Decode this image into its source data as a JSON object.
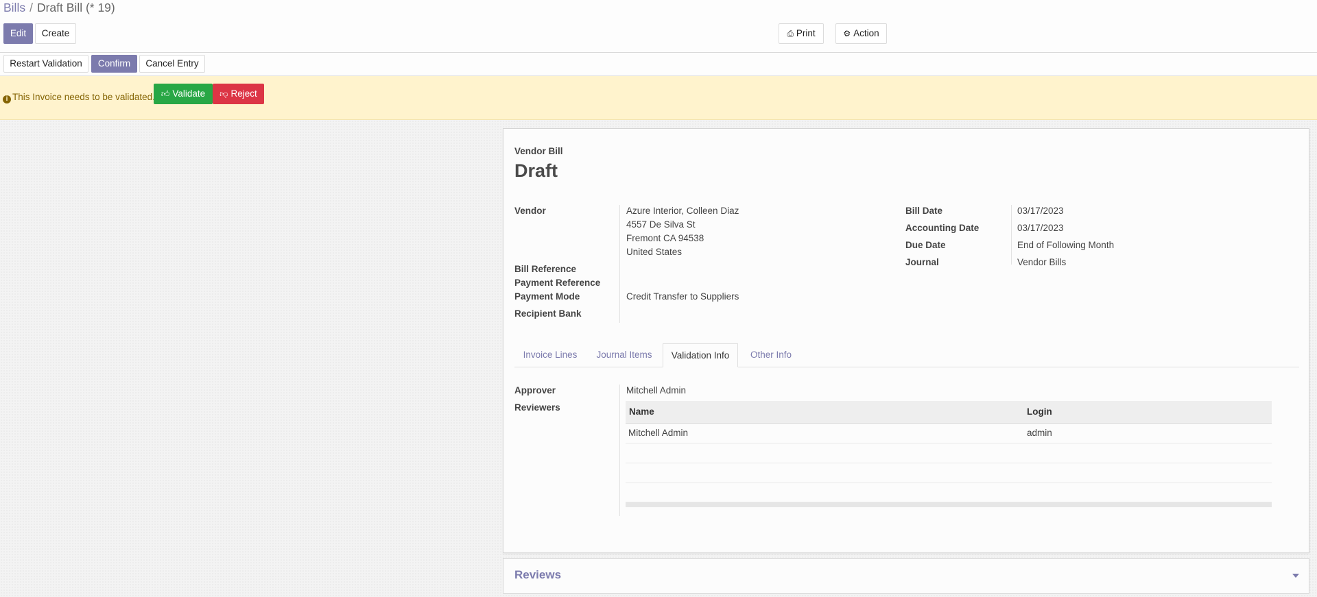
{
  "breadcrumb": {
    "parent": "Bills",
    "separator": "/",
    "current": "Draft Bill (* 19)"
  },
  "control_panel": {
    "edit_label": "Edit",
    "create_label": "Create",
    "print_label": "Print",
    "action_label": "Action"
  },
  "status_buttons": {
    "restart_label": "Restart Validation",
    "confirm_label": "Confirm",
    "cancel_label": "Cancel Entry"
  },
  "alert": {
    "message": "This Invoice needs to be validated.",
    "validate_label": "Validate",
    "reject_label": "Reject"
  },
  "sheet": {
    "subtitle": "Vendor Bill",
    "title": "Draft",
    "left_fields": {
      "vendor_label": "Vendor",
      "vendor_name": "Azure Interior, Colleen Diaz",
      "vendor_address_1": "4557 De Silva St",
      "vendor_address_2": "Fremont CA 94538",
      "vendor_address_3": "United States",
      "bill_reference_label": "Bill Reference",
      "payment_reference_label": "Payment Reference",
      "payment_mode_label": "Payment Mode",
      "payment_mode_value": "Credit Transfer to Suppliers",
      "recipient_bank_label": "Recipient Bank"
    },
    "right_fields": {
      "bill_date_label": "Bill Date",
      "bill_date_value": "03/17/2023",
      "accounting_date_label": "Accounting Date",
      "accounting_date_value": "03/17/2023",
      "due_date_label": "Due Date",
      "due_date_value": "End of Following Month",
      "journal_label": "Journal",
      "journal_value": "Vendor Bills"
    },
    "tabs": [
      {
        "label": "Invoice Lines"
      },
      {
        "label": "Journal Items"
      },
      {
        "label": "Validation Info"
      },
      {
        "label": "Other Info"
      }
    ],
    "validation_info": {
      "approver_label": "Approver",
      "approver_value": "Mitchell Admin",
      "reviewers_label": "Reviewers",
      "columns": [
        "Name",
        "Login"
      ],
      "rows": [
        {
          "name": "Mitchell Admin",
          "login": "admin"
        }
      ]
    }
  },
  "reviews": {
    "title": "Reviews"
  },
  "colors": {
    "primary": "#7c7bad",
    "success": "#28a745",
    "danger": "#dc3545",
    "alert_bg": "#fff3cd"
  }
}
